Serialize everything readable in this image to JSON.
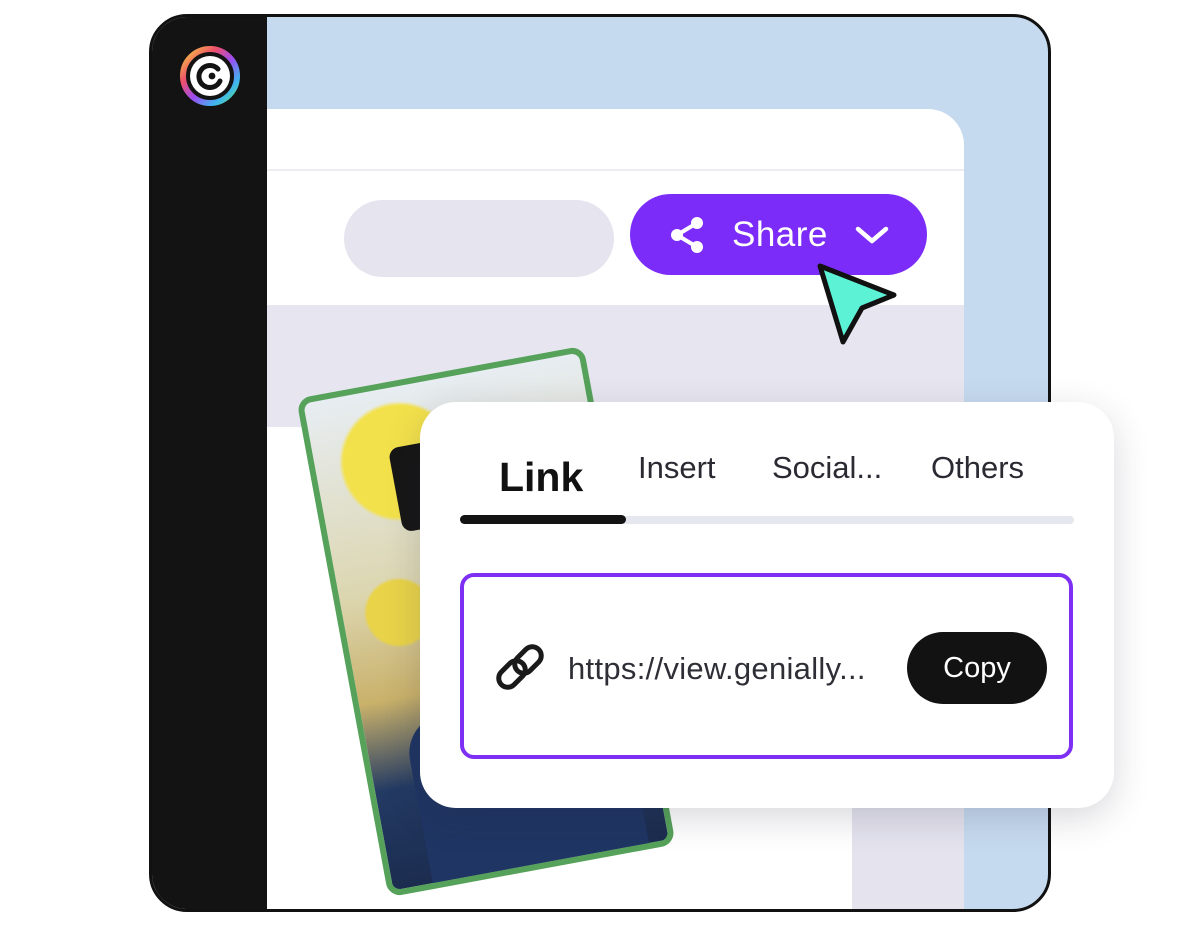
{
  "app": {
    "logo_icon": "genially-logo-icon",
    "colors": {
      "sidebar": "#131313",
      "canvas_bg": "#c6daef",
      "accent_purple": "#7c2cf9",
      "cursor_teal": "#5cf2d6",
      "photo_border": "#56a25a"
    }
  },
  "toolbar": {
    "share_label": "Share",
    "share_icon": "share-icon",
    "chevron_icon": "chevron-down-icon"
  },
  "share_popup": {
    "tabs": [
      {
        "label": "Link",
        "active": true
      },
      {
        "label": "Insert",
        "active": false
      },
      {
        "label": "Social...",
        "active": false
      },
      {
        "label": "Others",
        "active": false
      }
    ],
    "link": {
      "icon": "link-icon",
      "url": "https://view.genially...",
      "copy_label": "Copy"
    }
  }
}
